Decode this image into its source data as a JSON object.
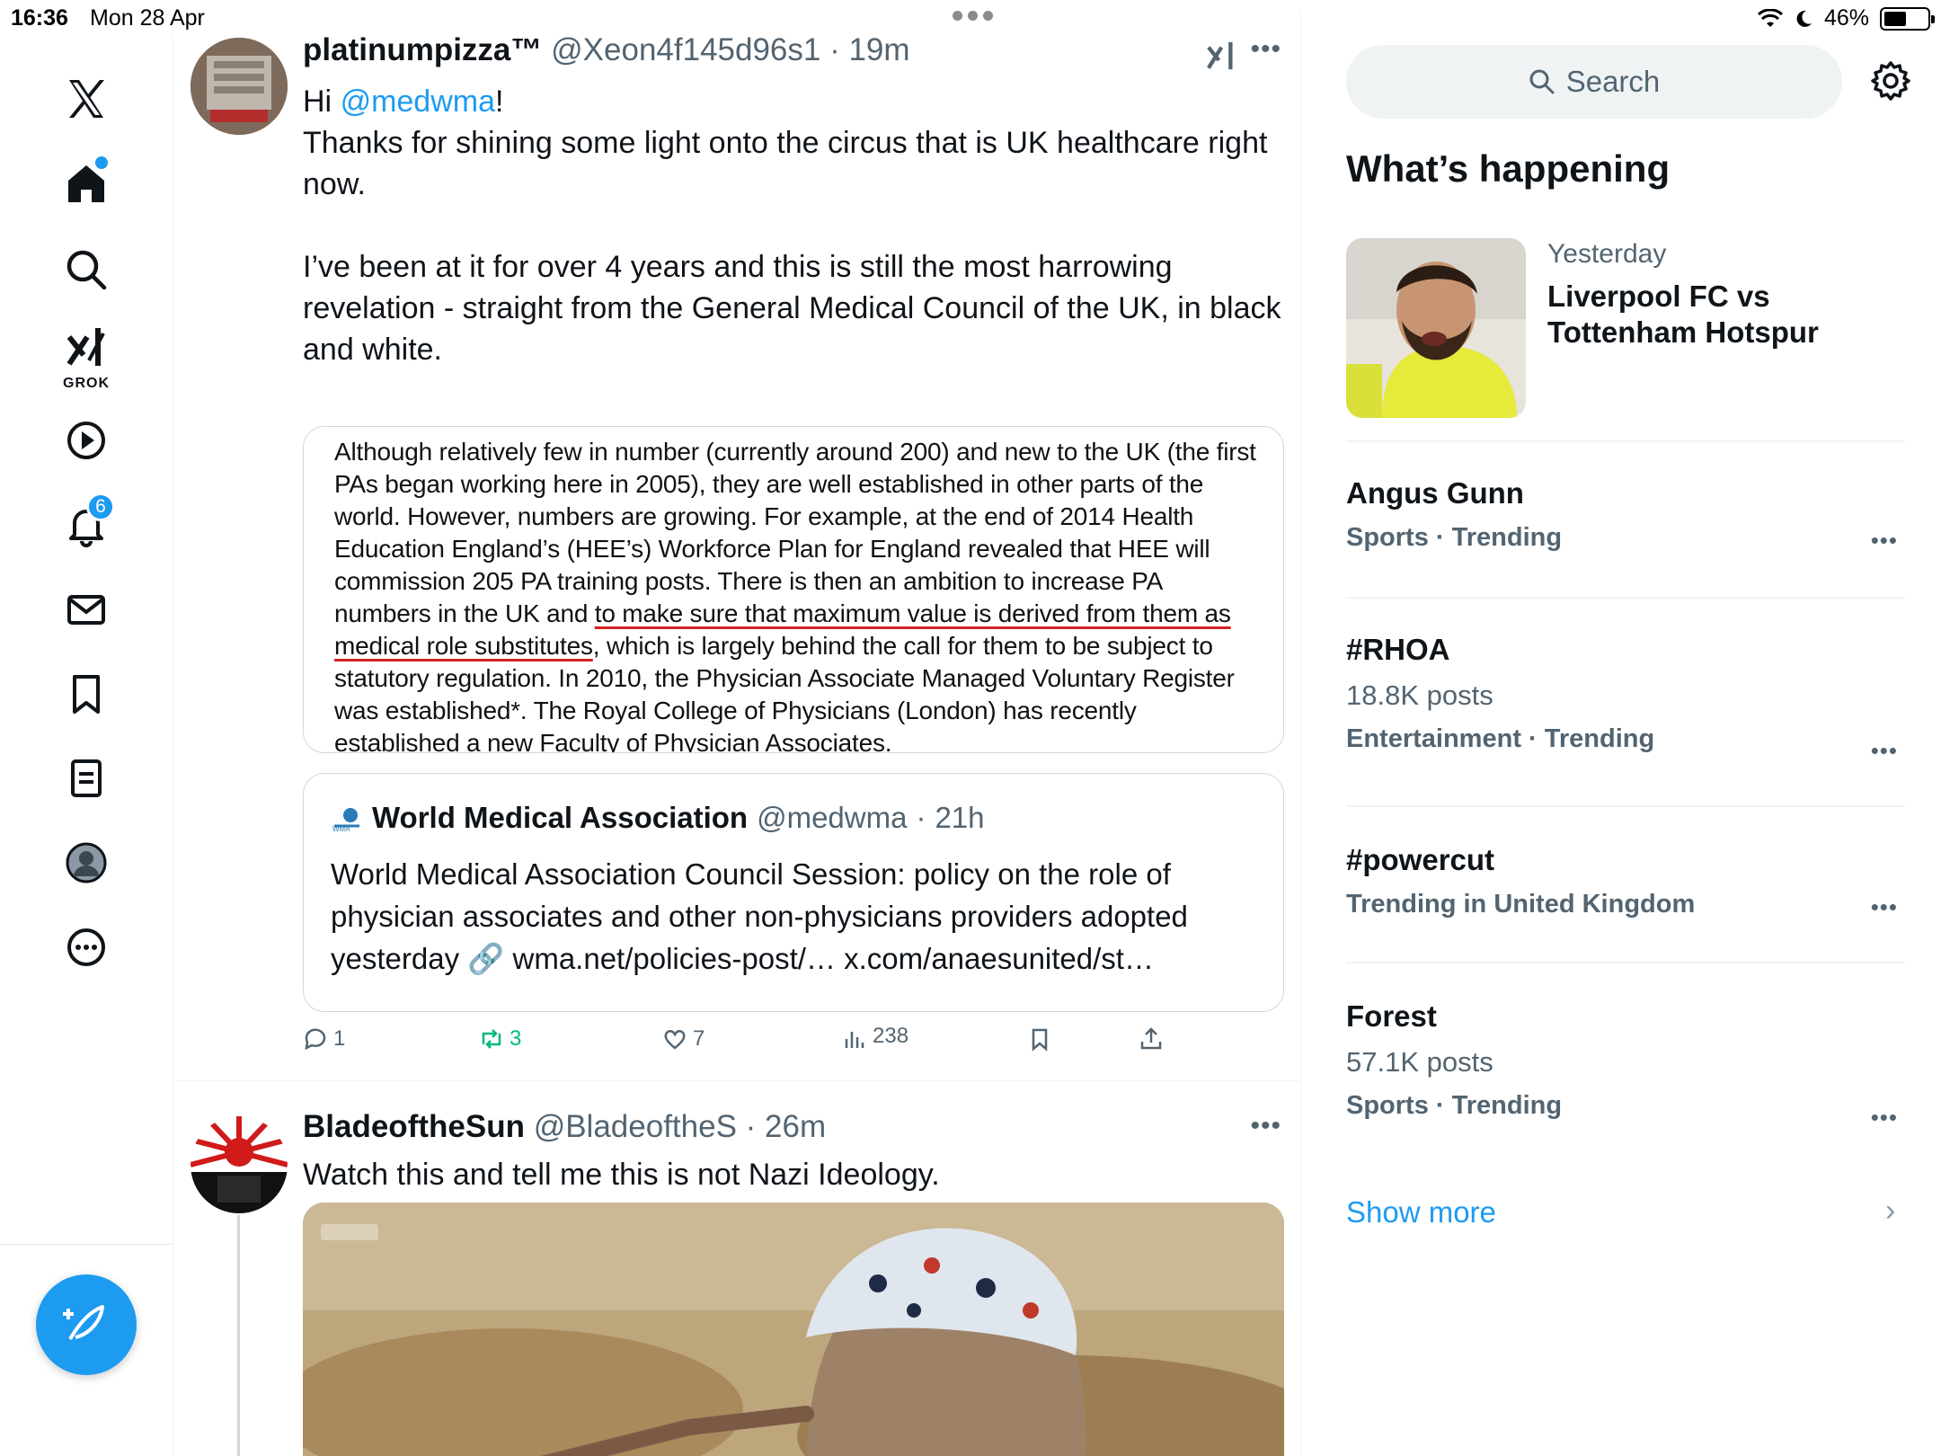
{
  "status": {
    "time": "16:36",
    "date": "Mon 28 Apr",
    "battery": "46%",
    "battery_level": 0.46
  },
  "nav": {
    "items": [
      {
        "name": "x-logo",
        "icon": "x-logo-icon"
      },
      {
        "name": "home",
        "icon": "home-icon",
        "has_dot": true
      },
      {
        "name": "explore",
        "icon": "search-icon"
      },
      {
        "name": "grok",
        "icon": "grok-icon",
        "label": "GROK"
      },
      {
        "name": "video",
        "icon": "play-icon"
      },
      {
        "name": "notifications",
        "icon": "bell-icon",
        "badge": "6"
      },
      {
        "name": "messages",
        "icon": "mail-icon"
      },
      {
        "name": "bookmarks",
        "icon": "bookmark-icon"
      },
      {
        "name": "lists",
        "icon": "list-icon"
      },
      {
        "name": "profile",
        "icon": "avatar-icon"
      },
      {
        "name": "more",
        "icon": "more-circle-icon"
      }
    ],
    "compose_icon": "compose-icon"
  },
  "tweets": [
    {
      "display_name": "platinumpizza™",
      "handle": "@Xeon4f145d96s1",
      "time": "19m",
      "greeting_prefix": "Hi ",
      "mention": "@medwma",
      "greeting_suffix": "!",
      "body": "\nThanks for shining some light onto the circus that is UK healthcare right now.\n\nI’ve been at it for over 4 years and this is still the most harrowing revelation - straight from the General Medical Council of the UK, in black and white.",
      "image_text_before": "Although relatively few in number (currently around 200) and new to the UK (the first PAs began working here in 2005), they are well established in other parts of the world. However, numbers are growing. For example, at the end of 2014 Health Education England’s (HEE’s) Workforce Plan for England revealed that HEE will commission 205 PA training posts. There is then an ambition to increase PA numbers in the UK and ",
      "image_text_underlined": "to make sure that maximum value is derived from them as medical role substitutes",
      "image_text_after": ", which is largely behind the call for them to be subject to statutory regulation. In 2010, the Physician Associate Managed Voluntary Register was established*. The Royal College of Physicians (London) has recently established a new Faculty of Physician Associates.",
      "quote": {
        "display_name": "World Medical Association",
        "handle": "@medwma",
        "time": "21h",
        "body": "World Medical Association Council Session: policy on the role of physician associates and other non-physicians providers adopted yesterday 🔗 wma.net/policies-post/… x.com/anaesunited/st…"
      },
      "actions": {
        "replies": "1",
        "reposts": "3",
        "likes": "7",
        "views": "238"
      }
    },
    {
      "display_name": "BladeoftheSun",
      "handle": "@BladeoftheS",
      "time": "26m",
      "body": "Watch this and tell me this is not Nazi Ideology."
    }
  ],
  "sidebar": {
    "search_placeholder": "Search",
    "title": "What’s happening",
    "featured": {
      "when": "Yesterday",
      "headline": "Liverpool FC vs Tottenham Hotspur"
    },
    "trends": [
      {
        "name": "Angus Gunn",
        "count": "",
        "category": "Sports · Trending"
      },
      {
        "name": "#RHOA",
        "count": "18.8K posts",
        "category": "Entertainment · Trending"
      },
      {
        "name": "#powercut",
        "count": "",
        "category": "Trending in United Kingdom"
      },
      {
        "name": "Forest",
        "count": "57.1K posts",
        "category": "Sports · Trending"
      }
    ],
    "show_more": "Show more"
  },
  "colors": {
    "accent": "#1d9bf0",
    "repost_green": "#00ba7c",
    "muted_text": "#536471",
    "underline_red": "#d62222"
  }
}
